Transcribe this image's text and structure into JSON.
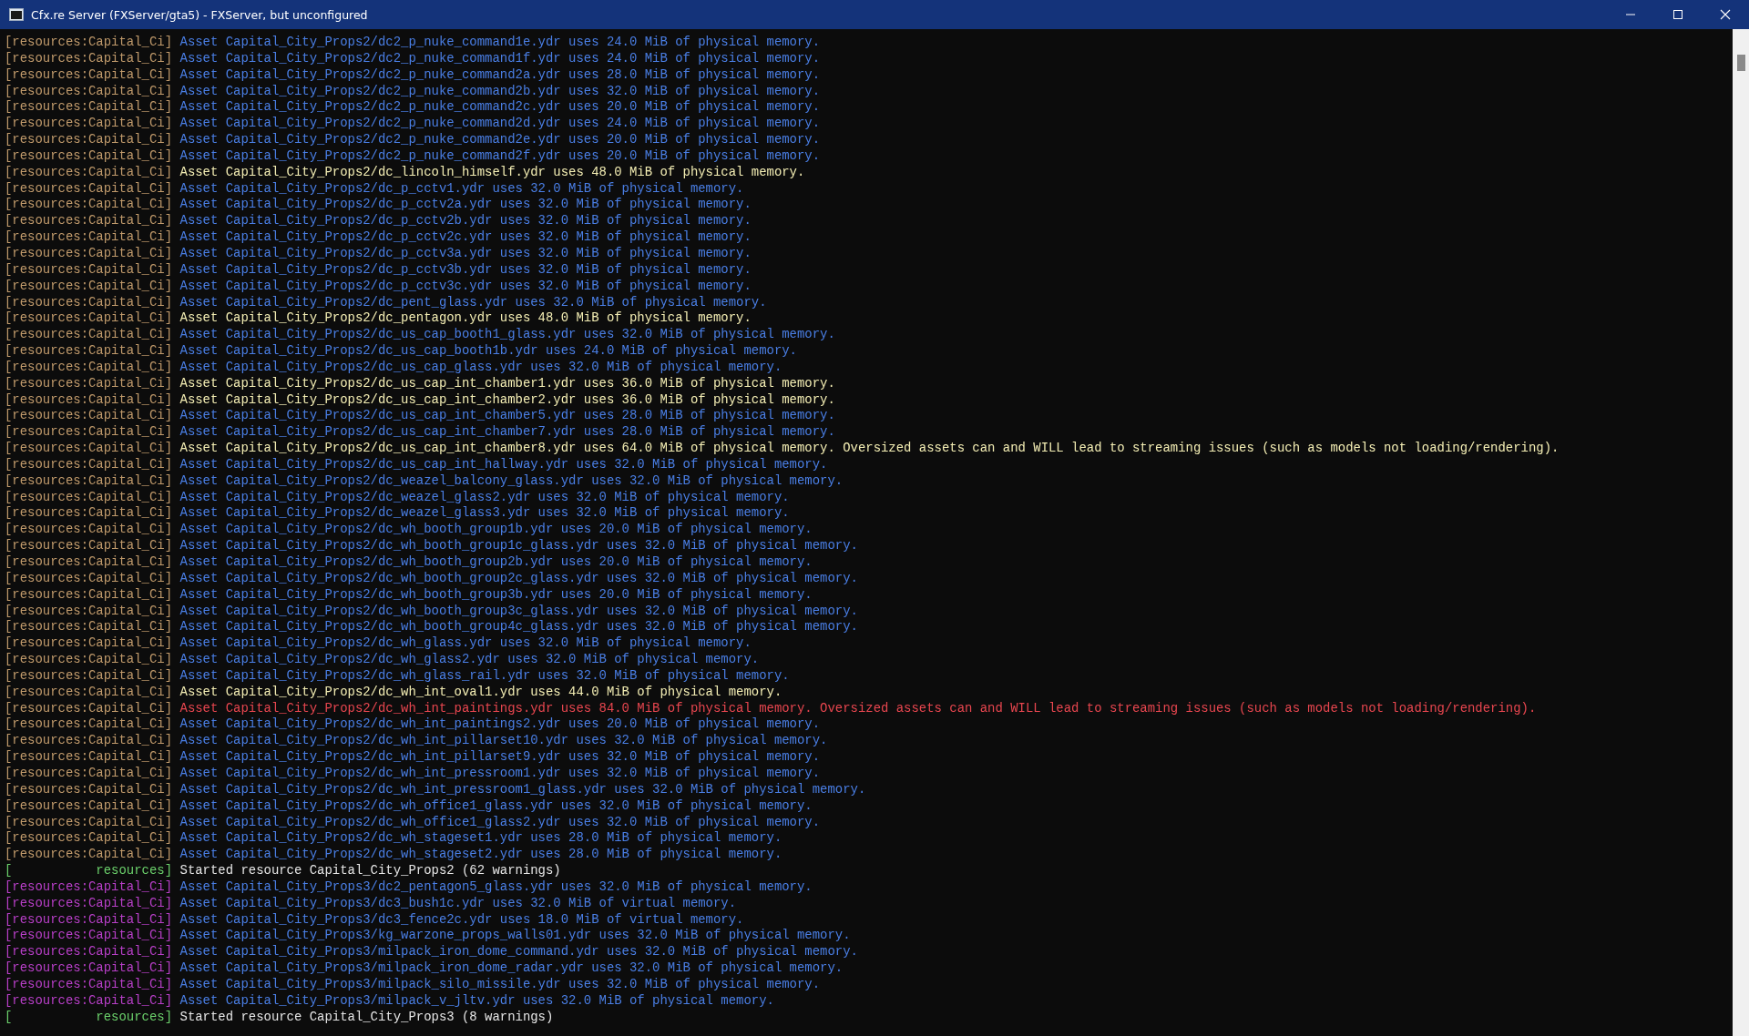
{
  "window": {
    "title": "Cfx.re Server (FXServer/gta5) - FXServer, but unconfigured"
  },
  "lines": [
    {
      "prefix": "[resources:Capital_Ci]",
      "color": "#c09a6b",
      "kind": "info",
      "message": "Asset Capital_City_Props2/dc2_p_nuke_command1e.ydr uses 24.0 MiB of physical memory."
    },
    {
      "prefix": "[resources:Capital_Ci]",
      "color": "#c09a6b",
      "kind": "info",
      "message": "Asset Capital_City_Props2/dc2_p_nuke_command1f.ydr uses 24.0 MiB of physical memory."
    },
    {
      "prefix": "[resources:Capital_Ci]",
      "color": "#c09a6b",
      "kind": "info",
      "message": "Asset Capital_City_Props2/dc2_p_nuke_command2a.ydr uses 28.0 MiB of physical memory."
    },
    {
      "prefix": "[resources:Capital_Ci]",
      "color": "#c09a6b",
      "kind": "info",
      "message": "Asset Capital_City_Props2/dc2_p_nuke_command2b.ydr uses 32.0 MiB of physical memory."
    },
    {
      "prefix": "[resources:Capital_Ci]",
      "color": "#c09a6b",
      "kind": "info",
      "message": "Asset Capital_City_Props2/dc2_p_nuke_command2c.ydr uses 20.0 MiB of physical memory."
    },
    {
      "prefix": "[resources:Capital_Ci]",
      "color": "#c09a6b",
      "kind": "info",
      "message": "Asset Capital_City_Props2/dc2_p_nuke_command2d.ydr uses 24.0 MiB of physical memory."
    },
    {
      "prefix": "[resources:Capital_Ci]",
      "color": "#c09a6b",
      "kind": "info",
      "message": "Asset Capital_City_Props2/dc2_p_nuke_command2e.ydr uses 20.0 MiB of physical memory."
    },
    {
      "prefix": "[resources:Capital_Ci]",
      "color": "#c09a6b",
      "kind": "info",
      "message": "Asset Capital_City_Props2/dc2_p_nuke_command2f.ydr uses 20.0 MiB of physical memory."
    },
    {
      "prefix": "[resources:Capital_Ci]",
      "color": "#c09a6b",
      "kind": "warning",
      "message": "Asset Capital_City_Props2/dc_lincoln_himself.ydr uses 48.0 MiB of physical memory."
    },
    {
      "prefix": "[resources:Capital_Ci]",
      "color": "#c09a6b",
      "kind": "info",
      "message": "Asset Capital_City_Props2/dc_p_cctv1.ydr uses 32.0 MiB of physical memory."
    },
    {
      "prefix": "[resources:Capital_Ci]",
      "color": "#c09a6b",
      "kind": "info",
      "message": "Asset Capital_City_Props2/dc_p_cctv2a.ydr uses 32.0 MiB of physical memory."
    },
    {
      "prefix": "[resources:Capital_Ci]",
      "color": "#c09a6b",
      "kind": "info",
      "message": "Asset Capital_City_Props2/dc_p_cctv2b.ydr uses 32.0 MiB of physical memory."
    },
    {
      "prefix": "[resources:Capital_Ci]",
      "color": "#c09a6b",
      "kind": "info",
      "message": "Asset Capital_City_Props2/dc_p_cctv2c.ydr uses 32.0 MiB of physical memory."
    },
    {
      "prefix": "[resources:Capital_Ci]",
      "color": "#c09a6b",
      "kind": "info",
      "message": "Asset Capital_City_Props2/dc_p_cctv3a.ydr uses 32.0 MiB of physical memory."
    },
    {
      "prefix": "[resources:Capital_Ci]",
      "color": "#c09a6b",
      "kind": "info",
      "message": "Asset Capital_City_Props2/dc_p_cctv3b.ydr uses 32.0 MiB of physical memory."
    },
    {
      "prefix": "[resources:Capital_Ci]",
      "color": "#c09a6b",
      "kind": "info",
      "message": "Asset Capital_City_Props2/dc_p_cctv3c.ydr uses 32.0 MiB of physical memory."
    },
    {
      "prefix": "[resources:Capital_Ci]",
      "color": "#c09a6b",
      "kind": "info",
      "message": "Asset Capital_City_Props2/dc_pent_glass.ydr uses 32.0 MiB of physical memory."
    },
    {
      "prefix": "[resources:Capital_Ci]",
      "color": "#c09a6b",
      "kind": "warning",
      "message": "Asset Capital_City_Props2/dc_pentagon.ydr uses 48.0 MiB of physical memory."
    },
    {
      "prefix": "[resources:Capital_Ci]",
      "color": "#c09a6b",
      "kind": "info",
      "message": "Asset Capital_City_Props2/dc_us_cap_booth1_glass.ydr uses 32.0 MiB of physical memory."
    },
    {
      "prefix": "[resources:Capital_Ci]",
      "color": "#c09a6b",
      "kind": "info",
      "message": "Asset Capital_City_Props2/dc_us_cap_booth1b.ydr uses 24.0 MiB of physical memory."
    },
    {
      "prefix": "[resources:Capital_Ci]",
      "color": "#c09a6b",
      "kind": "info",
      "message": "Asset Capital_City_Props2/dc_us_cap_glass.ydr uses 32.0 MiB of physical memory."
    },
    {
      "prefix": "[resources:Capital_Ci]",
      "color": "#c09a6b",
      "kind": "warning",
      "message": "Asset Capital_City_Props2/dc_us_cap_int_chamber1.ydr uses 36.0 MiB of physical memory."
    },
    {
      "prefix": "[resources:Capital_Ci]",
      "color": "#c09a6b",
      "kind": "warning",
      "message": "Asset Capital_City_Props2/dc_us_cap_int_chamber2.ydr uses 36.0 MiB of physical memory."
    },
    {
      "prefix": "[resources:Capital_Ci]",
      "color": "#c09a6b",
      "kind": "info",
      "message": "Asset Capital_City_Props2/dc_us_cap_int_chamber5.ydr uses 28.0 MiB of physical memory."
    },
    {
      "prefix": "[resources:Capital_Ci]",
      "color": "#c09a6b",
      "kind": "info",
      "message": "Asset Capital_City_Props2/dc_us_cap_int_chamber7.ydr uses 28.0 MiB of physical memory."
    },
    {
      "prefix": "[resources:Capital_Ci]",
      "color": "#c09a6b",
      "kind": "warning",
      "message": "Asset Capital_City_Props2/dc_us_cap_int_chamber8.ydr uses 64.0 MiB of physical memory. Oversized assets can and WILL lead to streaming issues (such as models not loading/rendering)."
    },
    {
      "prefix": "[resources:Capital_Ci]",
      "color": "#c09a6b",
      "kind": "info",
      "message": "Asset Capital_City_Props2/dc_us_cap_int_hallway.ydr uses 32.0 MiB of physical memory."
    },
    {
      "prefix": "[resources:Capital_Ci]",
      "color": "#c09a6b",
      "kind": "info",
      "message": "Asset Capital_City_Props2/dc_weazel_balcony_glass.ydr uses 32.0 MiB of physical memory."
    },
    {
      "prefix": "[resources:Capital_Ci]",
      "color": "#c09a6b",
      "kind": "info",
      "message": "Asset Capital_City_Props2/dc_weazel_glass2.ydr uses 32.0 MiB of physical memory."
    },
    {
      "prefix": "[resources:Capital_Ci]",
      "color": "#c09a6b",
      "kind": "info",
      "message": "Asset Capital_City_Props2/dc_weazel_glass3.ydr uses 32.0 MiB of physical memory."
    },
    {
      "prefix": "[resources:Capital_Ci]",
      "color": "#c09a6b",
      "kind": "info",
      "message": "Asset Capital_City_Props2/dc_wh_booth_group1b.ydr uses 20.0 MiB of physical memory."
    },
    {
      "prefix": "[resources:Capital_Ci]",
      "color": "#c09a6b",
      "kind": "info",
      "message": "Asset Capital_City_Props2/dc_wh_booth_group1c_glass.ydr uses 32.0 MiB of physical memory."
    },
    {
      "prefix": "[resources:Capital_Ci]",
      "color": "#c09a6b",
      "kind": "info",
      "message": "Asset Capital_City_Props2/dc_wh_booth_group2b.ydr uses 20.0 MiB of physical memory."
    },
    {
      "prefix": "[resources:Capital_Ci]",
      "color": "#c09a6b",
      "kind": "info",
      "message": "Asset Capital_City_Props2/dc_wh_booth_group2c_glass.ydr uses 32.0 MiB of physical memory."
    },
    {
      "prefix": "[resources:Capital_Ci]",
      "color": "#c09a6b",
      "kind": "info",
      "message": "Asset Capital_City_Props2/dc_wh_booth_group3b.ydr uses 20.0 MiB of physical memory."
    },
    {
      "prefix": "[resources:Capital_Ci]",
      "color": "#c09a6b",
      "kind": "info",
      "message": "Asset Capital_City_Props2/dc_wh_booth_group3c_glass.ydr uses 32.0 MiB of physical memory."
    },
    {
      "prefix": "[resources:Capital_Ci]",
      "color": "#c09a6b",
      "kind": "info",
      "message": "Asset Capital_City_Props2/dc_wh_booth_group4c_glass.ydr uses 32.0 MiB of physical memory."
    },
    {
      "prefix": "[resources:Capital_Ci]",
      "color": "#c09a6b",
      "kind": "info",
      "message": "Asset Capital_City_Props2/dc_wh_glass.ydr uses 32.0 MiB of physical memory."
    },
    {
      "prefix": "[resources:Capital_Ci]",
      "color": "#c09a6b",
      "kind": "info",
      "message": "Asset Capital_City_Props2/dc_wh_glass2.ydr uses 32.0 MiB of physical memory."
    },
    {
      "prefix": "[resources:Capital_Ci]",
      "color": "#c09a6b",
      "kind": "info",
      "message": "Asset Capital_City_Props2/dc_wh_glass_rail.ydr uses 32.0 MiB of physical memory."
    },
    {
      "prefix": "[resources:Capital_Ci]",
      "color": "#c09a6b",
      "kind": "warning",
      "message": "Asset Capital_City_Props2/dc_wh_int_oval1.ydr uses 44.0 MiB of physical memory."
    },
    {
      "prefix": "[resources:Capital_Ci]",
      "color": "#c09a6b",
      "kind": "error",
      "message": "Asset Capital_City_Props2/dc_wh_int_paintings.ydr uses 84.0 MiB of physical memory. Oversized assets can and WILL lead to streaming issues (such as models not loading/rendering)."
    },
    {
      "prefix": "[resources:Capital_Ci]",
      "color": "#c09a6b",
      "kind": "info",
      "message": "Asset Capital_City_Props2/dc_wh_int_paintings2.ydr uses 20.0 MiB of physical memory."
    },
    {
      "prefix": "[resources:Capital_Ci]",
      "color": "#c09a6b",
      "kind": "info",
      "message": "Asset Capital_City_Props2/dc_wh_int_pillarset10.ydr uses 32.0 MiB of physical memory."
    },
    {
      "prefix": "[resources:Capital_Ci]",
      "color": "#c09a6b",
      "kind": "info",
      "message": "Asset Capital_City_Props2/dc_wh_int_pillarset9.ydr uses 32.0 MiB of physical memory."
    },
    {
      "prefix": "[resources:Capital_Ci]",
      "color": "#c09a6b",
      "kind": "info",
      "message": "Asset Capital_City_Props2/dc_wh_int_pressroom1.ydr uses 32.0 MiB of physical memory."
    },
    {
      "prefix": "[resources:Capital_Ci]",
      "color": "#c09a6b",
      "kind": "info",
      "message": "Asset Capital_City_Props2/dc_wh_int_pressroom1_glass.ydr uses 32.0 MiB of physical memory."
    },
    {
      "prefix": "[resources:Capital_Ci]",
      "color": "#c09a6b",
      "kind": "info",
      "message": "Asset Capital_City_Props2/dc_wh_office1_glass.ydr uses 32.0 MiB of physical memory."
    },
    {
      "prefix": "[resources:Capital_Ci]",
      "color": "#c09a6b",
      "kind": "info",
      "message": "Asset Capital_City_Props2/dc_wh_office1_glass2.ydr uses 32.0 MiB of physical memory."
    },
    {
      "prefix": "[resources:Capital_Ci]",
      "color": "#c09a6b",
      "kind": "info",
      "message": "Asset Capital_City_Props2/dc_wh_stageset1.ydr uses 28.0 MiB of physical memory."
    },
    {
      "prefix": "[resources:Capital_Ci]",
      "color": "#c09a6b",
      "kind": "info",
      "message": "Asset Capital_City_Props2/dc_wh_stageset2.ydr uses 28.0 MiB of physical memory."
    },
    {
      "prefix": "[           resources]",
      "color": "#6bd06b",
      "kind": "status",
      "message": "Started resource Capital_City_Props2 (62 warnings)"
    },
    {
      "prefix": "[resources:Capital_Ci]",
      "color": "#b83fc8",
      "kind": "info",
      "message": "Asset Capital_City_Props3/dc2_pentagon5_glass.ydr uses 32.0 MiB of physical memory."
    },
    {
      "prefix": "[resources:Capital_Ci]",
      "color": "#b83fc8",
      "kind": "info",
      "message": "Asset Capital_City_Props3/dc3_bush1c.ydr uses 32.0 MiB of virtual memory."
    },
    {
      "prefix": "[resources:Capital_Ci]",
      "color": "#b83fc8",
      "kind": "info",
      "message": "Asset Capital_City_Props3/dc3_fence2c.ydr uses 18.0 MiB of virtual memory."
    },
    {
      "prefix": "[resources:Capital_Ci]",
      "color": "#b83fc8",
      "kind": "info",
      "message": "Asset Capital_City_Props3/kg_warzone_props_walls01.ydr uses 32.0 MiB of physical memory."
    },
    {
      "prefix": "[resources:Capital_Ci]",
      "color": "#b83fc8",
      "kind": "info",
      "message": "Asset Capital_City_Props3/milpack_iron_dome_command.ydr uses 32.0 MiB of physical memory."
    },
    {
      "prefix": "[resources:Capital_Ci]",
      "color": "#b83fc8",
      "kind": "info",
      "message": "Asset Capital_City_Props3/milpack_iron_dome_radar.ydr uses 32.0 MiB of physical memory."
    },
    {
      "prefix": "[resources:Capital_Ci]",
      "color": "#b83fc8",
      "kind": "info",
      "message": "Asset Capital_City_Props3/milpack_silo_missile.ydr uses 32.0 MiB of physical memory."
    },
    {
      "prefix": "[resources:Capital_Ci]",
      "color": "#b83fc8",
      "kind": "info",
      "message": "Asset Capital_City_Props3/milpack_v_jltv.ydr uses 32.0 MiB of physical memory."
    },
    {
      "prefix": "[           resources]",
      "color": "#6bd06b",
      "kind": "status",
      "message": "Started resource Capital_City_Props3 (8 warnings)"
    }
  ]
}
